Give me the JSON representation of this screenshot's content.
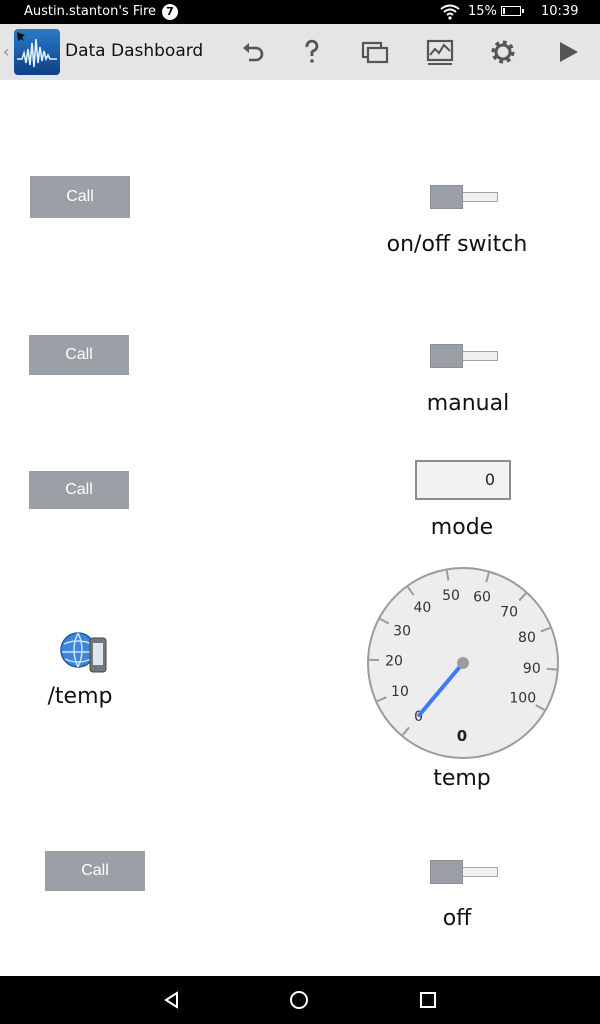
{
  "status_bar": {
    "owner": "Austin.stanton's Fire",
    "notification_count": "7",
    "battery": "15%",
    "time": "10:39",
    "battery_level": 0.15
  },
  "app_bar": {
    "title": "Data Dashboard"
  },
  "widgets": {
    "call_labels": [
      "Call",
      "Call",
      "Call",
      "Call"
    ],
    "switch1_label": "on/off switch",
    "switch2_label": "manual",
    "mode_label": "mode",
    "mode_value": "0",
    "topic_label": "/temp",
    "gauge": {
      "label": "temp",
      "value": "0",
      "min": 0,
      "max": 100,
      "ticks": [
        "0",
        "10",
        "20",
        "30",
        "40",
        "50",
        "60",
        "70",
        "80",
        "90",
        "100"
      ]
    },
    "switch3_label": "off"
  },
  "colors": {
    "button_gray": "#9aa0a6",
    "gauge_needle": "#3a7bff",
    "app_bar_bg": "#e5e5e5"
  }
}
